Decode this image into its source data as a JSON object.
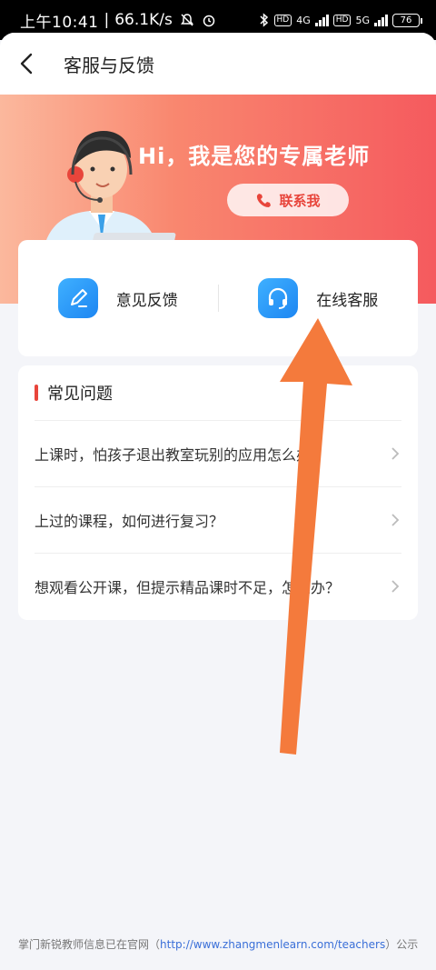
{
  "status": {
    "time": "上午10:41",
    "speed": "66.1K/s",
    "hd1": "HD",
    "net1": "4G",
    "hd2": "HD",
    "net2": "5G",
    "battery": "76"
  },
  "nav": {
    "title": "客服与反馈"
  },
  "banner": {
    "greeting": "Hi，我是您的专属老师",
    "contact_label": "联系我"
  },
  "actions": {
    "feedback_label": "意见反馈",
    "service_label": "在线客服"
  },
  "faq": {
    "title": "常见问题",
    "items": [
      "上课时，怕孩子退出教室玩别的应用怎么办？",
      "上过的课程，如何进行复习？",
      "想观看公开课，但提示精品课时不足，怎么办？"
    ]
  },
  "footer": {
    "prefix": "掌门新锐教师信息已在官网（",
    "link": "http://www.zhangmenlearn.com/teachers",
    "suffix": "）公示"
  },
  "colors": {
    "accent": "#e8453b",
    "brand_blue": "#1d86f2",
    "arrow": "#f47a3c"
  }
}
